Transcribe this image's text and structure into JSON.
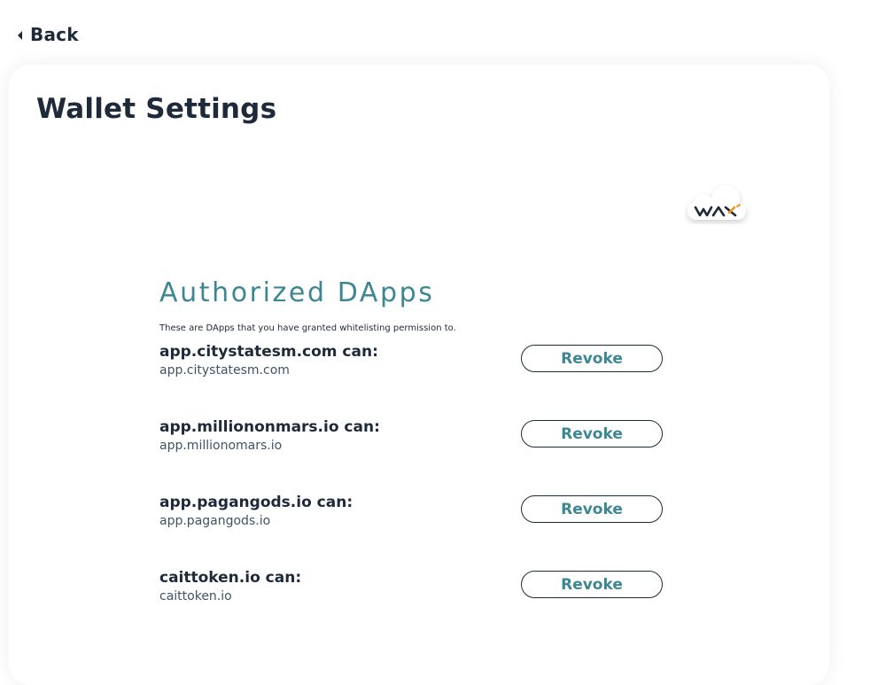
{
  "nav": {
    "back_label": "Back",
    "back_icon": "caret-left-icon"
  },
  "page": {
    "title": "Wallet Settings"
  },
  "logo": {
    "text": "WAX",
    "icon": "wax-cloud-logo",
    "accent_color": "#f7931a"
  },
  "authorized_dapps": {
    "title": "Authorized DApps",
    "description": "These are DApps that you have granted whitelisting permission to.",
    "items": [
      {
        "name": "app.citystatesm.com can:",
        "domain": "app.citystatesm.com",
        "action_label": "Revoke"
      },
      {
        "name": "app.milliononmars.io can:",
        "domain": "app.millionomars.io",
        "action_label": "Revoke"
      },
      {
        "name": "app.pagangods.io can:",
        "domain": "app.pagangods.io",
        "action_label": "Revoke"
      },
      {
        "name": "caittoken.io can:",
        "domain": "caittoken.io",
        "action_label": "Revoke"
      }
    ]
  },
  "colors": {
    "heading": "#1e2a3a",
    "accent_teal": "#3c8793",
    "subtext": "#3f5563"
  }
}
